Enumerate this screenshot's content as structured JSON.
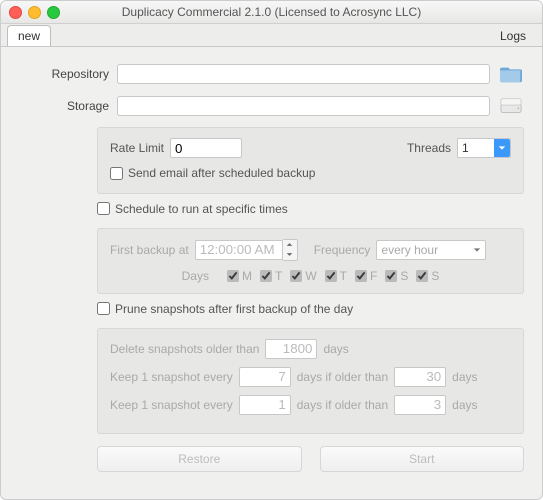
{
  "window": {
    "title": "Duplicacy Commercial 2.1.0 (Licensed to Acrosync LLC)"
  },
  "tabs": {
    "new": "new",
    "logs": "Logs"
  },
  "repository": {
    "label": "Repository",
    "value": ""
  },
  "storage": {
    "label": "Storage",
    "value": ""
  },
  "rate": {
    "label": "Rate Limit",
    "value": "0"
  },
  "threads": {
    "label": "Threads",
    "value": "1"
  },
  "send_email": {
    "label": "Send email after scheduled backup",
    "checked": false
  },
  "schedule": {
    "label": "Schedule to run at specific times",
    "checked": false
  },
  "first_backup": {
    "label": "First backup at",
    "value": "12:00:00 AM"
  },
  "frequency": {
    "label": "Frequency",
    "value": "every hour"
  },
  "days": {
    "label": "Days",
    "items": [
      {
        "label": "M",
        "checked": true
      },
      {
        "label": "T",
        "checked": true
      },
      {
        "label": "W",
        "checked": true
      },
      {
        "label": "T",
        "checked": true
      },
      {
        "label": "F",
        "checked": true
      },
      {
        "label": "S",
        "checked": true
      },
      {
        "label": "S",
        "checked": true
      }
    ]
  },
  "prune": {
    "label": "Prune snapshots after first backup of the day",
    "checked": false
  },
  "prune_rules": {
    "delete_label_pre": "Delete snapshots older than",
    "delete_value": "1800",
    "delete_label_post": "days",
    "keep1_pre": "Keep 1 snapshot every",
    "keep1_val1": "7",
    "keep1_mid": "days if older than",
    "keep1_val2": "30",
    "keep1_post": "days",
    "keep2_pre": "Keep 1 snapshot every",
    "keep2_val1": "1",
    "keep2_mid": "days if older than",
    "keep2_val2": "3",
    "keep2_post": "days"
  },
  "buttons": {
    "restore": "Restore",
    "start": "Start"
  }
}
